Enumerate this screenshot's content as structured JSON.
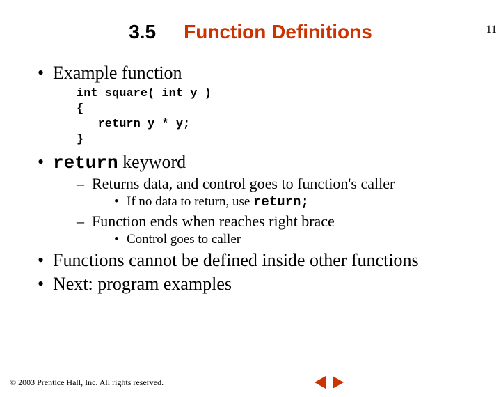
{
  "page_number": "11",
  "header": {
    "section_number": "3.5",
    "section_title": "Function Definitions"
  },
  "bullets": {
    "b1": "Example function",
    "code": "int square( int y )\n{\n   return y * y;\n}",
    "b2_pre": "return",
    "b2_post": " keyword",
    "b2_sub1": "Returns data, and control goes to function's caller",
    "b2_sub1_sub_pre": "If no data to return, use ",
    "b2_sub1_sub_code": "return;",
    "b2_sub2": "Function ends when reaches right brace",
    "b2_sub2_sub": "Control goes to caller",
    "b3": "Functions cannot be defined inside other functions",
    "b4": "Next: program examples"
  },
  "footer": {
    "copyright": "© 2003 Prentice Hall, Inc. All rights reserved."
  },
  "colors": {
    "accent": "#cc3300"
  }
}
